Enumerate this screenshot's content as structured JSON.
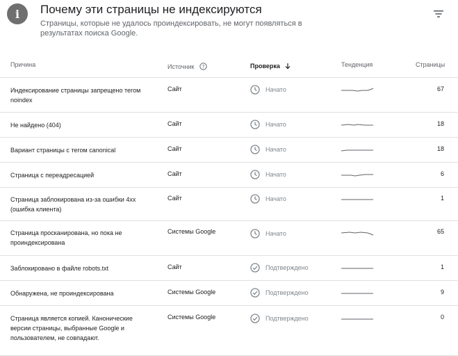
{
  "header": {
    "title": "Почему эти страницы не индексируются",
    "subtitle": "Страницы, которые не удалось проиндексировать, не могут появляться в результатах поиска Google.",
    "info_icon": "info-icon",
    "filter_icon": "filter-icon"
  },
  "columns": {
    "reason": "Причина",
    "source": "Источник",
    "validation": "Проверка",
    "trend": "Тенденция",
    "pages": "Страницы"
  },
  "rows": [
    {
      "reason": "Индексирование страницы запрещено тегом noindex",
      "source": "Сайт",
      "status": "Начато",
      "status_type": "started",
      "pages": "67"
    },
    {
      "reason": "Не найдено (404)",
      "source": "Сайт",
      "status": "Начато",
      "status_type": "started",
      "pages": "18"
    },
    {
      "reason": "Вариант страницы с тегом canonical",
      "source": "Сайт",
      "status": "Начато",
      "status_type": "started",
      "pages": "18"
    },
    {
      "reason": "Страница с переадресацией",
      "source": "Сайт",
      "status": "Начато",
      "status_type": "started",
      "pages": "6"
    },
    {
      "reason": "Страница заблокирована из-за ошибки 4xx (ошибка клиента)",
      "source": "Сайт",
      "status": "Начато",
      "status_type": "started",
      "pages": "1"
    },
    {
      "reason": "Страница просканирована, но пока не проиндексирована",
      "source": "Системы Google",
      "status": "Начато",
      "status_type": "started",
      "pages": "65"
    },
    {
      "reason": "Заблокировано в файле robots.txt",
      "source": "Сайт",
      "status": "Подтверждено",
      "status_type": "passed",
      "pages": "1"
    },
    {
      "reason": "Обнаружена, не проиндексирована",
      "source": "Системы Google",
      "status": "Подтверждено",
      "status_type": "passed",
      "pages": "9"
    },
    {
      "reason": "Страница является копией. Канонические версии страницы, выбранные Google и пользователем, не совпадают.",
      "source": "Системы Google",
      "status": "Подтверждено",
      "status_type": "passed",
      "pages": "0"
    }
  ],
  "colors": {
    "icon_grey": "#6f6f6f",
    "status_grey": "#80868b",
    "sparkline": "#5f6368",
    "divider": "#e0e0e0"
  }
}
